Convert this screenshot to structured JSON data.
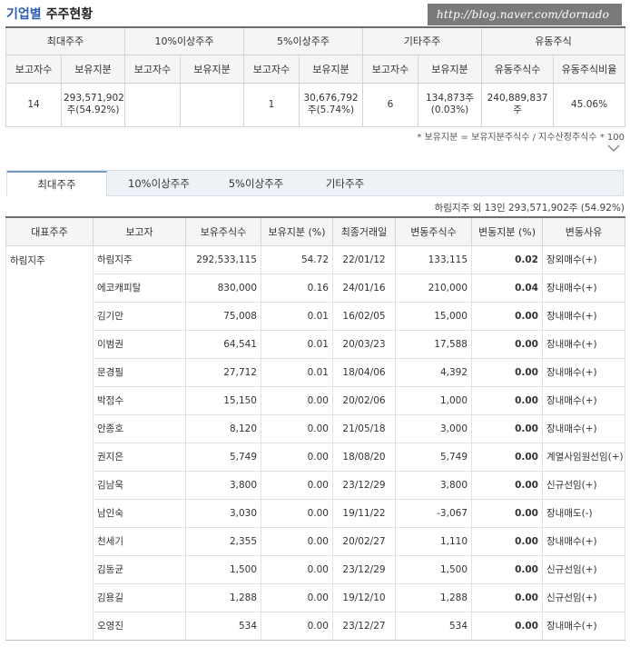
{
  "header": {
    "title_accent": "기업별",
    "title_rest": "주주현황",
    "watermark": "http://blog.naver.com/dornado"
  },
  "summary": {
    "groups": [
      "최대주주",
      "10%이상주주",
      "5%이상주주",
      "기타주주",
      "유동주식"
    ],
    "subheaders": [
      "보고자수",
      "보유지분",
      "보고자수",
      "보유지분",
      "보고자수",
      "보유지분",
      "보고자수",
      "보유지분",
      "유동주식수",
      "유동주식비율"
    ],
    "values": [
      "14",
      "293,571,902주(54.92%)",
      "",
      "",
      "1",
      "30,676,792주(5.74%)",
      "6",
      "134,873주(0.03%)",
      "240,889,837주",
      "45.06%"
    ],
    "note": "* 보유지분 = 보유지분주식수 / 지수산정주식수 * 100"
  },
  "tabs": [
    "최대주주",
    "10%이상주주",
    "5%이상주주",
    "기타주주"
  ],
  "active_tab": "최대주주",
  "subinfo": "하림지주 외 13인 293,571,902주 (54.92%)",
  "detail": {
    "columns": [
      "대표주주",
      "보고자",
      "보유주식수",
      "보유지분 (%)",
      "최종거래일",
      "변동주식수",
      "변동지분 (%)",
      "변동사유"
    ],
    "representative": "하림지주",
    "rows": [
      [
        "하림지주",
        "292,533,115",
        "54.72",
        "22/01/12",
        "133,115",
        "0.02",
        "장외매수(+)"
      ],
      [
        "에코캐피탈",
        "830,000",
        "0.16",
        "24/01/16",
        "210,000",
        "0.04",
        "장내매수(+)"
      ],
      [
        "김기만",
        "75,008",
        "0.01",
        "16/02/05",
        "15,000",
        "0.00",
        "장내매수(+)"
      ],
      [
        "이범권",
        "64,541",
        "0.01",
        "20/03/23",
        "17,588",
        "0.00",
        "장내매수(+)"
      ],
      [
        "문경필",
        "27,712",
        "0.01",
        "18/04/06",
        "4,392",
        "0.00",
        "장내매수(+)"
      ],
      [
        "박점수",
        "15,150",
        "0.00",
        "20/02/06",
        "1,000",
        "0.00",
        "장내매수(+)"
      ],
      [
        "안종호",
        "8,120",
        "0.00",
        "21/05/18",
        "3,000",
        "0.00",
        "장내매수(+)"
      ],
      [
        "권지은",
        "5,749",
        "0.00",
        "18/08/20",
        "5,749",
        "0.00",
        "계열사임원선임(+)"
      ],
      [
        "김남욱",
        "3,800",
        "0.00",
        "23/12/29",
        "3,800",
        "0.00",
        "신규선임(+)"
      ],
      [
        "남인숙",
        "3,030",
        "0.00",
        "19/11/22",
        "-3,067",
        "0.00",
        "장내매도(-)"
      ],
      [
        "천세기",
        "2,355",
        "0.00",
        "20/02/27",
        "1,110",
        "0.00",
        "장내매수(+)"
      ],
      [
        "김동균",
        "1,500",
        "0.00",
        "23/12/29",
        "1,500",
        "0.00",
        "신규선임(+)"
      ],
      [
        "김용길",
        "1,288",
        "0.00",
        "19/12/10",
        "1,288",
        "0.00",
        "신규선임(+)"
      ],
      [
        "오영진",
        "534",
        "0.00",
        "23/12/27",
        "534",
        "0.00",
        "장내매수(+)"
      ]
    ]
  }
}
